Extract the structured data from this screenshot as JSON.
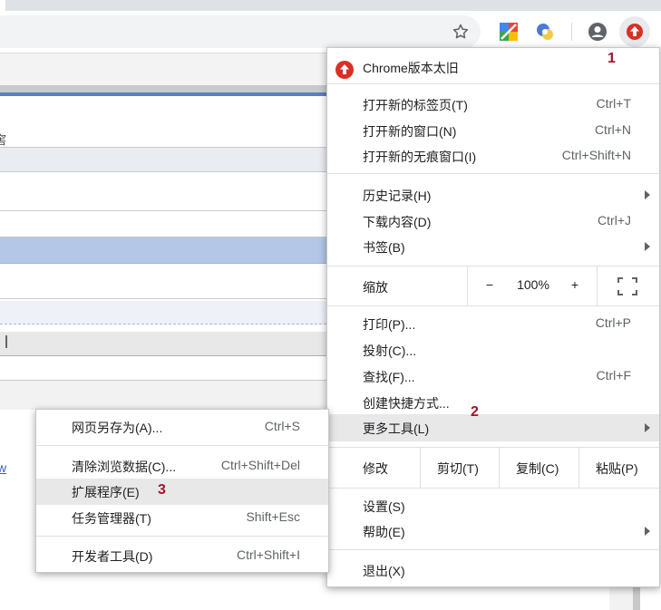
{
  "toolbar": {
    "star_icon": "star-icon",
    "extensions": [
      "colorful-extension-icon",
      "translate-extension-icon"
    ],
    "profile_icon": "account-circle-icon",
    "update_icon": "update-arrow-icon"
  },
  "menu": {
    "update_banner": "Chrome版本太旧",
    "items_group1": [
      {
        "label": "打开新的标签页(T)",
        "shortcut": "Ctrl+T"
      },
      {
        "label": "打开新的窗口(N)",
        "shortcut": "Ctrl+N"
      },
      {
        "label": "打开新的无痕窗口(I)",
        "shortcut": "Ctrl+Shift+N"
      }
    ],
    "items_group2": [
      {
        "label": "历史记录(H)",
        "shortcut": ""
      },
      {
        "label": "下载内容(D)",
        "shortcut": "Ctrl+J"
      },
      {
        "label": "书签(B)",
        "shortcut": ""
      }
    ],
    "zoom": {
      "label": "缩放",
      "minus": "−",
      "value": "100%",
      "plus": "+"
    },
    "items_group3": [
      {
        "label": "打印(P)...",
        "shortcut": "Ctrl+P"
      },
      {
        "label": "投射(C)...",
        "shortcut": ""
      },
      {
        "label": "查找(F)...",
        "shortcut": "Ctrl+F"
      },
      {
        "label": "创建快捷方式...",
        "shortcut": ""
      },
      {
        "label": "更多工具(L)",
        "shortcut": ""
      }
    ],
    "edit": {
      "label": "修改",
      "cut": "剪切(T)",
      "copy": "复制(C)",
      "paste": "粘贴(P)"
    },
    "items_group4": [
      {
        "label": "设置(S)",
        "shortcut": ""
      },
      {
        "label": "帮助(E)",
        "shortcut": ""
      }
    ],
    "exit": "退出(X)"
  },
  "submenu": {
    "items": [
      {
        "label": "网页另存为(A)...",
        "shortcut": "Ctrl+S"
      },
      {
        "label": "清除浏览数据(C)...",
        "shortcut": "Ctrl+Shift+Del"
      },
      {
        "label": "扩展程序(E)",
        "shortcut": ""
      },
      {
        "label": "任务管理器(T)",
        "shortcut": "Shift+Esc"
      },
      {
        "label": "开发者工具(D)",
        "shortcut": "Ctrl+Shift+I"
      }
    ]
  },
  "page": {
    "left_fragment_1": "窖",
    "left_fragment_2": "w"
  },
  "annotations": {
    "step1": "1",
    "step2": "2",
    "step3": "3"
  },
  "colors": {
    "annotation": "#a0162b",
    "update_red": "#d93025",
    "highlight": "#e8e8e8",
    "page_blue": "#b4c7e7"
  }
}
